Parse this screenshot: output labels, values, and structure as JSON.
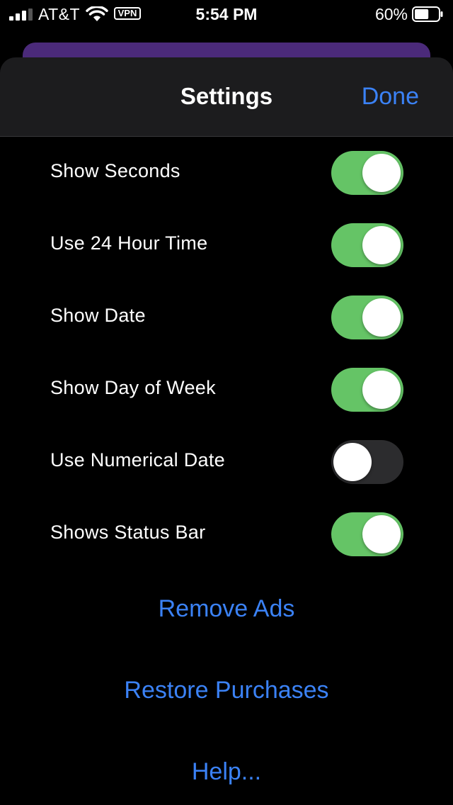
{
  "status_bar": {
    "carrier": "AT&T",
    "vpn": "VPN",
    "time": "5:54 PM",
    "battery_percent": "60%",
    "battery_level": 0.6,
    "signal_bars": 3,
    "icons": [
      "signal-icon",
      "wifi-icon",
      "vpn-icon",
      "battery-icon"
    ]
  },
  "nav": {
    "title": "Settings",
    "done_label": "Done"
  },
  "settings": [
    {
      "label": "Show Seconds",
      "on": true
    },
    {
      "label": "Use 24 Hour Time",
      "on": true
    },
    {
      "label": "Show Date",
      "on": true
    },
    {
      "label": "Show Day of Week",
      "on": true
    },
    {
      "label": "Use Numerical Date",
      "on": false
    },
    {
      "label": "Shows Status Bar",
      "on": true
    }
  ],
  "actions": {
    "remove_ads": "Remove Ads",
    "restore_purchases": "Restore Purchases",
    "help": "Help..."
  },
  "colors": {
    "accent": "#3b82f6",
    "toggle_on": "#65c466",
    "toggle_off": "#2c2c2e",
    "nav_background": "#1c1c1e",
    "peek_card": "#4b2a7a"
  }
}
